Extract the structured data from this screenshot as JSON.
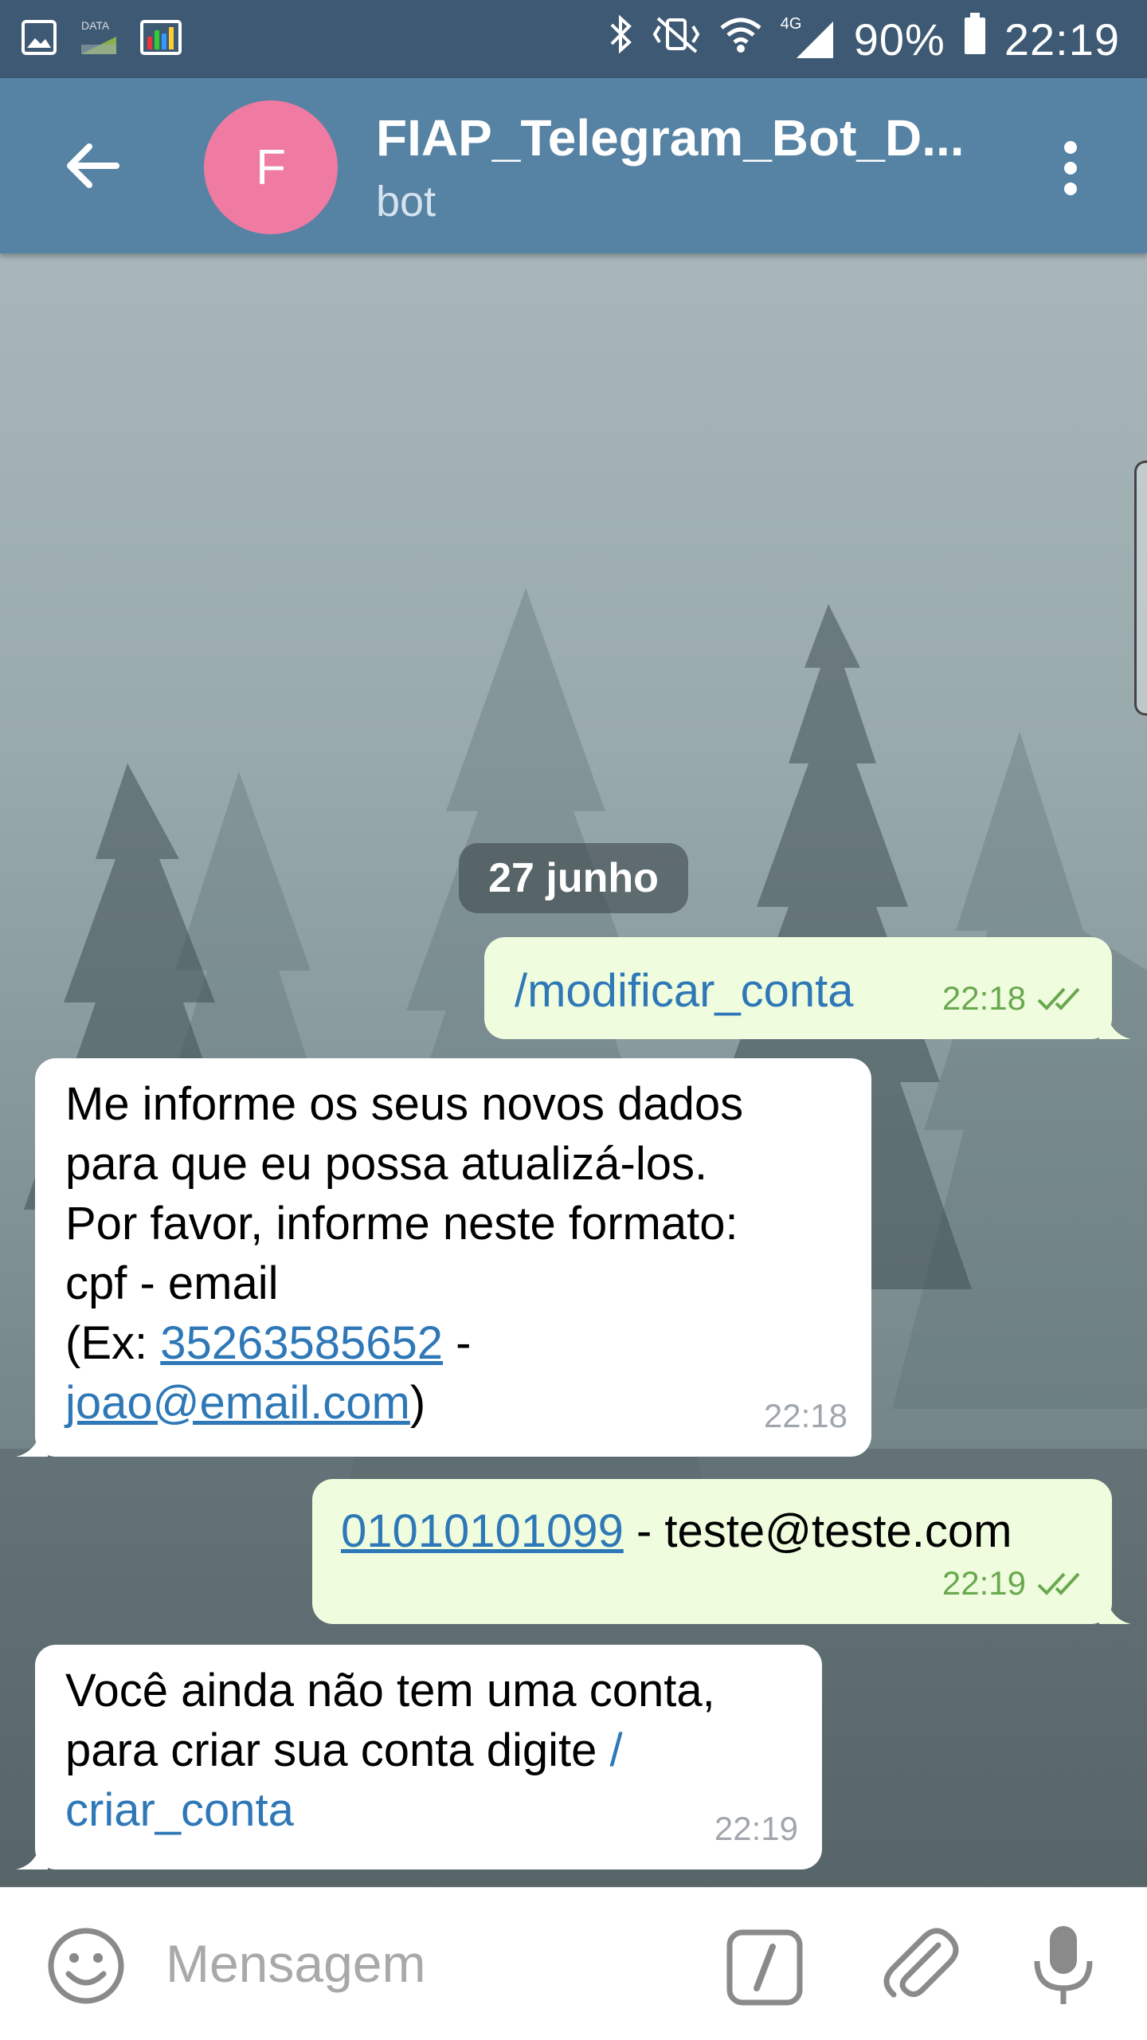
{
  "status_bar": {
    "data_label": "DATA",
    "network": "4G",
    "battery": "90%",
    "time": "22:19"
  },
  "header": {
    "avatar_letter": "F",
    "title": "FIAP_Telegram_Bot_D...",
    "subtitle": "bot"
  },
  "chat": {
    "date_separator": "27 junho",
    "messages": [
      {
        "direction": "out",
        "text": "/modificar_conta",
        "time": "22:18",
        "read": true
      },
      {
        "direction": "in",
        "lines": [
          "Me informe os seus novos dados",
          "para que eu possa atualizá-los.",
          "Por favor, informe neste formato:",
          "cpf - email"
        ],
        "example_prefix": "(Ex: ",
        "example_cpf": "35263585652",
        "example_sep": " -",
        "example_email": "joao@email.com",
        "example_suffix": ")",
        "time": "22:18"
      },
      {
        "direction": "out",
        "cpf": "01010101099",
        "rest": " - teste@teste.com",
        "time": "22:19",
        "read": true
      },
      {
        "direction": "in",
        "lines": [
          "Você ainda não tem uma conta,",
          "para criar sua conta digite "
        ],
        "cmd_part1": "/",
        "cmd_part2": "criar_conta",
        "time": "22:19"
      }
    ]
  },
  "composer": {
    "placeholder": "Mensagem"
  },
  "icons": {
    "back": "arrow-left-icon",
    "menu": "more-vertical-icon",
    "emoji": "smiley-icon",
    "commands": "bot-command-icon",
    "attach": "paperclip-icon",
    "mic": "microphone-icon"
  },
  "colors": {
    "status_bar": "#3e5973",
    "app_bar": "#5682a3",
    "avatar": "#f07ba2",
    "outgoing_bubble": "#effdde",
    "incoming_bubble": "#ffffff",
    "link": "#2f78b7",
    "read_check": "#6aa84f"
  }
}
